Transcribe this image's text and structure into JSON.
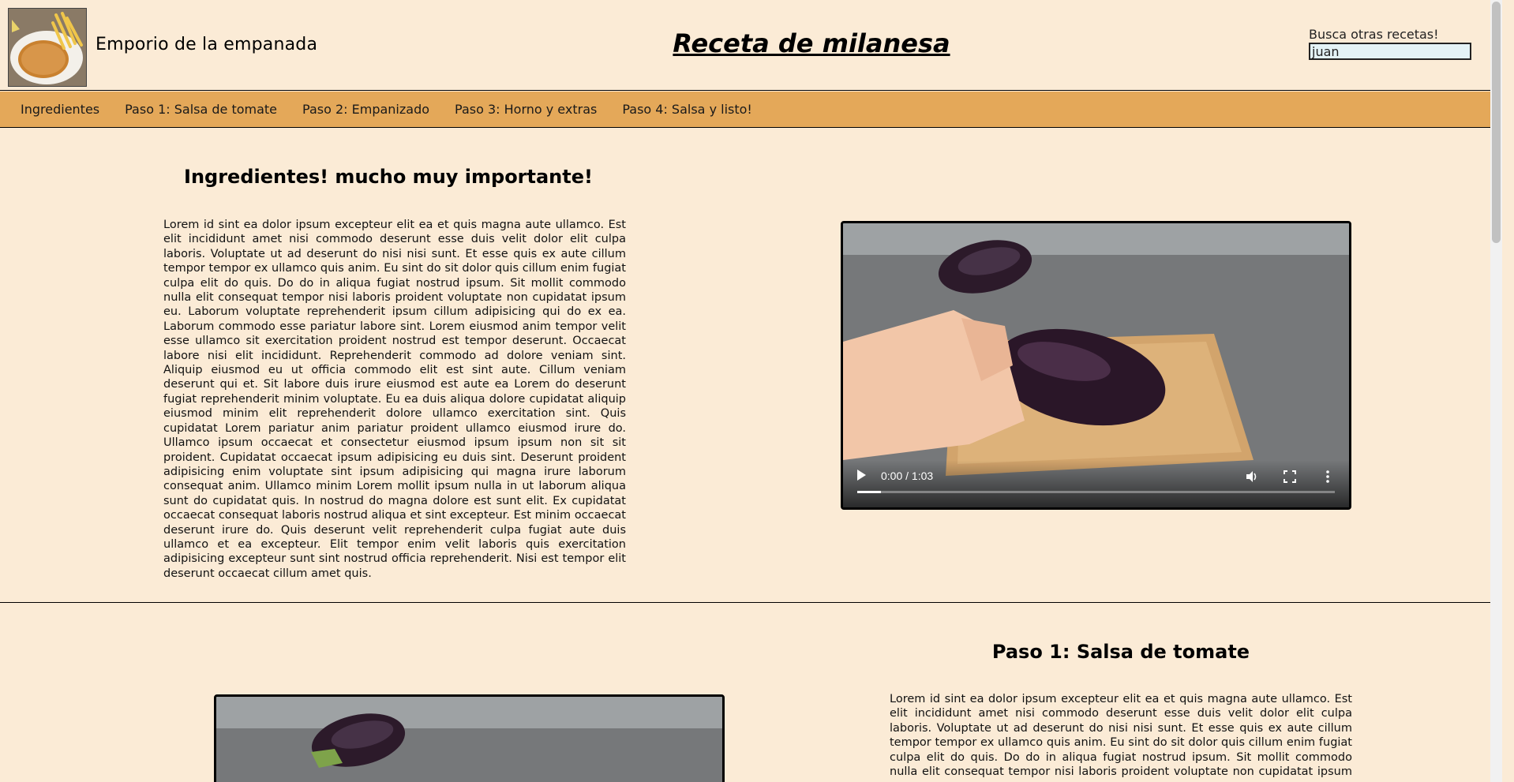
{
  "header": {
    "brand": "Emporio de la empanada",
    "title": "Receta de milanesa",
    "search": {
      "label": "Busca otras recetas!",
      "value": "juan"
    }
  },
  "nav": {
    "items": [
      {
        "label": "Ingredientes"
      },
      {
        "label": "Paso 1: Salsa de tomate"
      },
      {
        "label": "Paso 2: Empanizado"
      },
      {
        "label": "Paso 3: Horno y extras"
      },
      {
        "label": "Paso 4: Salsa y listo!"
      }
    ]
  },
  "sections": [
    {
      "title": "Ingredientes! mucho muy importante!",
      "text": "Lorem id sint ea dolor ipsum excepteur elit ea et quis magna aute ullamco. Est elit incididunt amet nisi commodo deserunt esse duis velit dolor elit culpa laboris. Voluptate ut ad deserunt do nisi nisi sunt. Et esse quis ex aute cillum tempor tempor ex ullamco quis anim. Eu sint do sit dolor quis cillum enim fugiat culpa elit do quis. Do do in aliqua fugiat nostrud ipsum. Sit mollit commodo nulla elit consequat tempor nisi laboris proident voluptate non cupidatat ipsum eu. Laborum voluptate reprehenderit ipsum cillum adipisicing qui do ex ea. Laborum commodo esse pariatur labore sint. Lorem eiusmod anim tempor velit esse ullamco sit exercitation proident nostrud est tempor deserunt. Occaecat labore nisi elit incididunt. Reprehenderit commodo ad dolore veniam sint. Aliquip eiusmod eu ut officia commodo elit est sint aute. Cillum veniam deserunt qui et. Sit labore duis irure eiusmod est aute ea Lorem do deserunt fugiat reprehenderit minim voluptate. Eu ea duis aliqua dolore cupidatat aliquip eiusmod minim elit reprehenderit dolore ullamco exercitation sint. Quis cupidatat Lorem pariatur anim pariatur proident ullamco eiusmod irure do. Ullamco ipsum occaecat et consectetur eiusmod ipsum ipsum non sit sit proident. Cupidatat occaecat ipsum adipisicing eu duis sint. Deserunt proident adipisicing enim voluptate sint ipsum adipisicing qui magna irure laborum consequat anim. Ullamco minim Lorem mollit ipsum nulla in ut laborum aliqua sunt do cupidatat quis. In nostrud do magna dolore est sunt elit. Ex cupidatat occaecat consequat laboris nostrud aliqua et sint excepteur. Est minim occaecat deserunt irure do. Quis deserunt velit reprehenderit culpa fugiat aute duis ullamco et ea excepteur. Elit tempor enim velit laboris quis exercitation adipisicing excepteur sunt sint nostrud officia reprehenderit. Nisi est tempor elit deserunt occaecat cillum amet quis.",
      "video": {
        "time": "0:00 / 1:03",
        "progress": 0.05
      }
    },
    {
      "title": "Paso 1: Salsa de tomate",
      "text": "Lorem id sint ea dolor ipsum excepteur elit ea et quis magna aute ullamco. Est elit incididunt amet nisi commodo deserunt esse duis velit dolor elit culpa laboris. Voluptate ut ad deserunt do nisi nisi sunt. Et esse quis ex aute cillum tempor tempor ex ullamco quis anim. Eu sint do sit dolor quis cillum enim fugiat culpa elit do quis. Do do in aliqua fugiat nostrud ipsum. Sit mollit commodo nulla elit consequat tempor nisi laboris proident voluptate non cupidatat ipsum eu."
    }
  ],
  "colors": {
    "page_bg": "#fbebd6",
    "nav_bg": "#e4a859",
    "search_bg": "#e4f3f6"
  }
}
